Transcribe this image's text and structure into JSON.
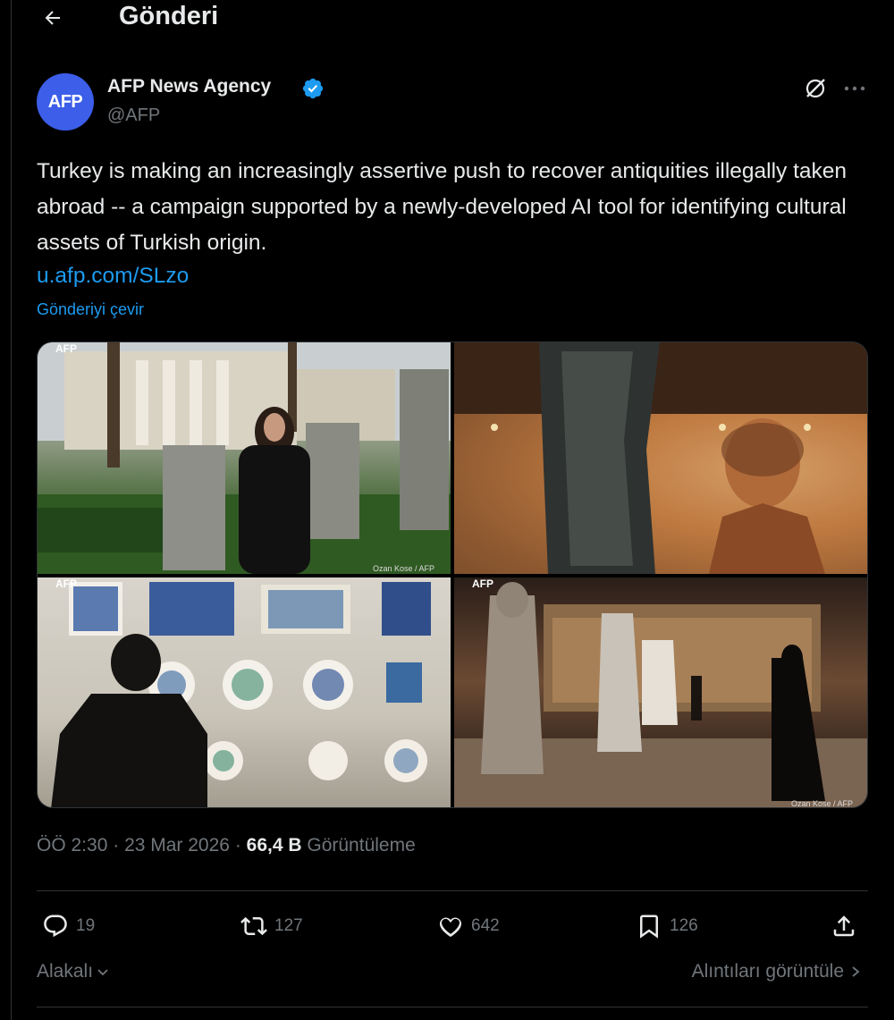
{
  "header": {
    "title": "Gönderi"
  },
  "author": {
    "avatar_text": "AFP",
    "name": "AFP News Agency",
    "handle": "@AFP",
    "avatar_color": "#3c5ee8",
    "verified_color": "#1d9bf0"
  },
  "tweet": {
    "text": "Turkey is making an increasingly assertive push to recover antiquities illegally taken abroad -- a campaign supported by a newly-developed AI tool for identifying cultural assets of Turkish origin.",
    "link": "u.afp.com/SLzo",
    "translate": "Gönderiyi çevir"
  },
  "media": {
    "photos": [
      {
        "watermark": "AFP",
        "credit": "Ozan Kose / AFP"
      },
      {
        "watermark": "",
        "credit": ""
      },
      {
        "watermark": "AFP",
        "credit": ""
      },
      {
        "watermark": "AFP",
        "credit": "Ozan Kose / AFP"
      }
    ]
  },
  "meta": {
    "time": "ÖÖ 2:30",
    "date": "23 Mar 2026",
    "views_count": "66,4 B",
    "views_label": "Görüntüleme"
  },
  "actions": {
    "replies": "19",
    "reposts": "127",
    "likes": "642",
    "bookmarks": "126"
  },
  "footer": {
    "related": "Alakalı",
    "quotes": "Alıntıları görüntüle"
  },
  "colors": {
    "accent": "#1d9bf0",
    "muted": "#71767b",
    "text": "#e7e9ea",
    "background": "#000000"
  }
}
